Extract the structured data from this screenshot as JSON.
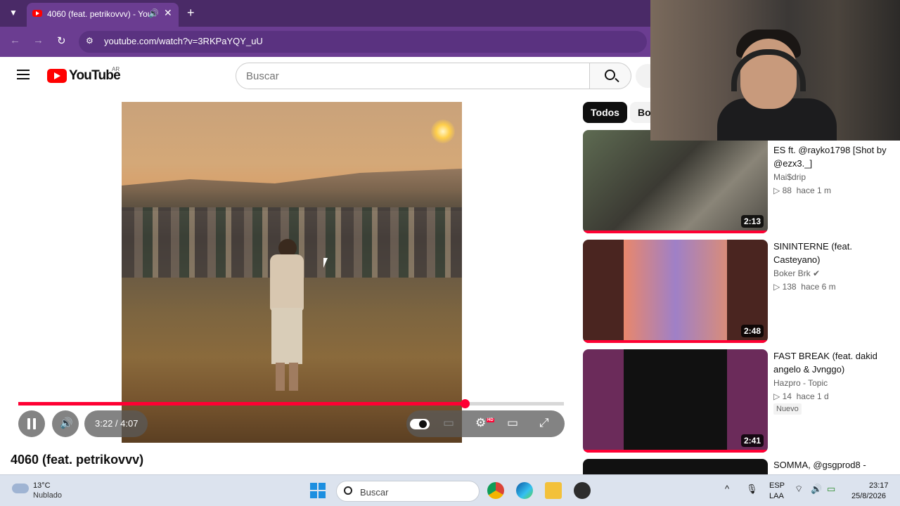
{
  "browser": {
    "tab_title": "4060 (feat. petrikovvv) - You",
    "url": "youtube.com/watch?v=3RKPaYQY_uU"
  },
  "header": {
    "logo_text": "YouTube",
    "country_code": "AR",
    "search_placeholder": "Buscar"
  },
  "player": {
    "time": "3:22 / 4:07",
    "progress_fraction": 0.818,
    "hd_badge": "HD"
  },
  "video": {
    "title": "4060 (feat. petrikovvv)"
  },
  "chips": [
    "Todos",
    "Boli"
  ],
  "related": [
    {
      "title": "ES ft. @rayko1798 [Shot by @ezx3._]",
      "channel": "Mai$drip",
      "views": "88",
      "age": "hace 1 m",
      "duration": "2:13",
      "badge": ""
    },
    {
      "title": "SININTERNE (feat. Casteyano)",
      "channel": "Boker Brk",
      "views": "138",
      "age": "hace 6 m",
      "duration": "2:48",
      "badge": ""
    },
    {
      "title": "FAST BREAK (feat. dakid angelo & Jvnggo)",
      "channel": "Hazpro - Topic",
      "views": "14",
      "age": "hace 1 d",
      "duration": "2:41",
      "badge": "Nuevo"
    },
    {
      "title": "SOMMA, @gsgprod8 -",
      "channel": "",
      "views": "",
      "age": "",
      "duration": "",
      "badge": ""
    }
  ],
  "taskbar": {
    "temperature": "13°C",
    "weather": "Nublado",
    "search_label": "Buscar",
    "lang1": "ESP",
    "lang2": "LAA",
    "time": "23:17",
    "date": "25/8/2026"
  },
  "colors": {
    "browser_frame": "#6b3d91",
    "yt_red": "#ff0000",
    "progress_red": "#ff0033"
  }
}
